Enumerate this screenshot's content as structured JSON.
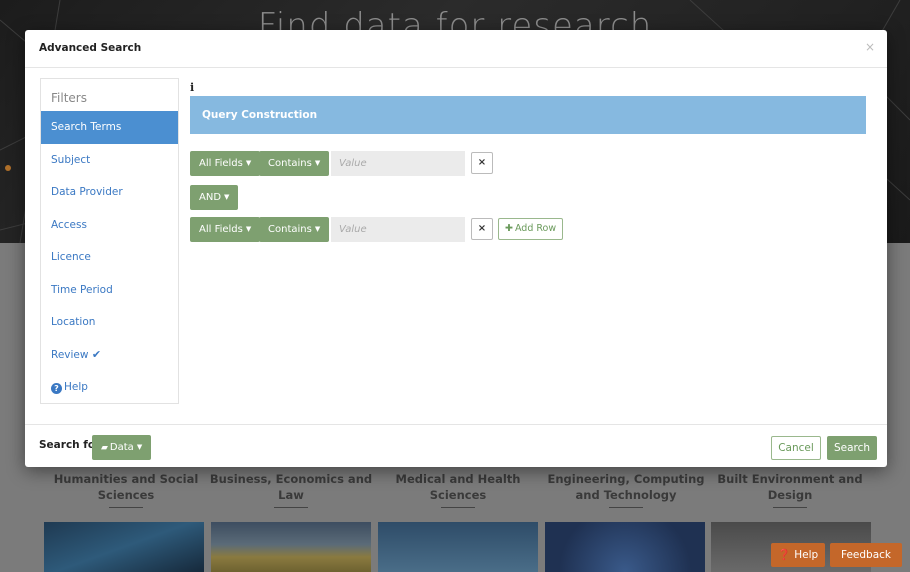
{
  "background": {
    "hero_title": "Find data for research",
    "categories": [
      {
        "label": "Humanities and Social Sciences"
      },
      {
        "label": "Business, Economics and Law"
      },
      {
        "label": "Medical and Health Sciences"
      },
      {
        "label": "Engineering, Computing and Technology"
      },
      {
        "label": "Built Environment and Design"
      }
    ],
    "help_button": "Help",
    "feedback_button": "Feedback"
  },
  "modal": {
    "title": "Advanced Search",
    "close_label": "×",
    "info_label": "i",
    "query_header": "Query Construction"
  },
  "sidebar": {
    "heading": "Filters",
    "items": [
      {
        "label": "Search Terms"
      },
      {
        "label": "Subject"
      },
      {
        "label": "Data Provider"
      },
      {
        "label": "Access"
      },
      {
        "label": "Licence"
      },
      {
        "label": "Time Period"
      },
      {
        "label": "Location"
      },
      {
        "label": "Review"
      },
      {
        "label": "Help"
      }
    ]
  },
  "query": {
    "rows": [
      {
        "field": "All Fields",
        "operator": "Contains",
        "value": "",
        "placeholder": "Value"
      },
      {
        "field": "All Fields",
        "operator": "Contains",
        "value": "",
        "placeholder": "Value"
      }
    ],
    "conjunction": "AND",
    "remove_label": "×",
    "add_row_label": "Add Row"
  },
  "footer": {
    "search_for_label": "Search for",
    "search_type": "Data",
    "cancel_label": "Cancel",
    "search_label": "Search"
  },
  "colors": {
    "accent_green": "#7ea070",
    "active_blue": "#4b8fd1",
    "query_header_blue": "#86b9e0",
    "link_blue": "#3a78c3",
    "orange": "#e07a2a"
  }
}
